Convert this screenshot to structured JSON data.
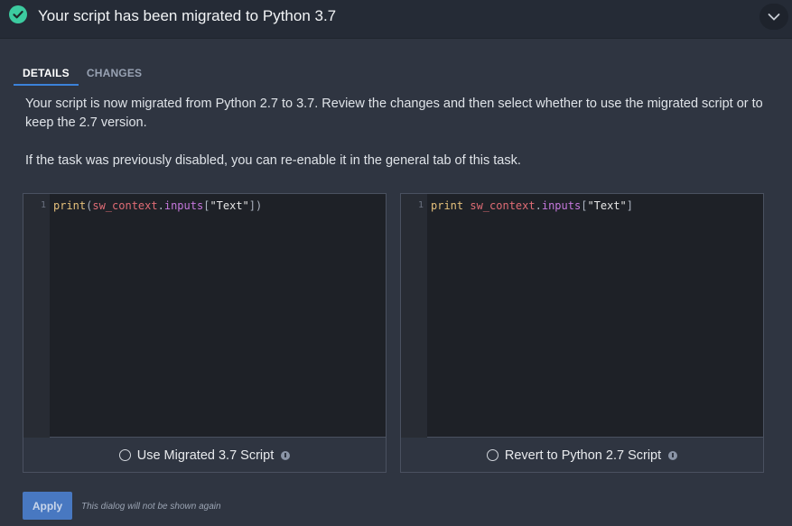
{
  "header": {
    "title": "Your script has been migrated to Python 3.7",
    "accent_color": "#3ccba0"
  },
  "tabs": [
    {
      "label": "DETAILS",
      "active": true
    },
    {
      "label": "CHANGES",
      "active": false
    }
  ],
  "description": {
    "paragraph1": "Your script is now migrated from Python 2.7 to 3.7. Review the changes and then select whether to use the migrated script or to keep the 2.7 version.",
    "paragraph2": "If the task was previously disabled, you can re-enable it in the general tab of this task."
  },
  "editors": {
    "migrated": {
      "line_number": "1",
      "code": "print(sw_context.inputs[\"Text\"])",
      "option_label": "Use Migrated 3.7 Script"
    },
    "original": {
      "line_number": "1",
      "code": "print sw_context.inputs[\"Text\"]",
      "option_label": "Revert to Python 2.7 Script"
    }
  },
  "footer": {
    "apply_label": "Apply",
    "note": "This dialog will not be shown again"
  }
}
